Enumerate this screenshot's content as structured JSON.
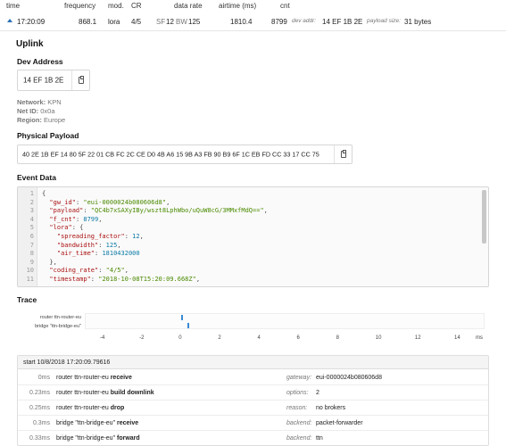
{
  "columns": {
    "time": "time",
    "frequency": "frequency",
    "mod": "mod.",
    "cr": "CR",
    "data_rate": "data rate",
    "airtime": "airtime (ms)",
    "cnt": "cnt"
  },
  "row": {
    "time": "17:20:09",
    "frequency": "868.1",
    "mod": "lora",
    "cr": "4/5",
    "sf_label": "SF",
    "sf": "12",
    "bw_label": "BW",
    "bw": "125",
    "airtime": "1810.4",
    "cnt": "8799",
    "dev_addr_label": "dev addr:",
    "dev_addr": "14 EF 1B 2E",
    "payload_size_label": "payload size:",
    "payload_size": "31 bytes"
  },
  "uplink": {
    "title": "Uplink",
    "dev_address_title": "Dev Address",
    "dev_address": "14 EF 1B 2E",
    "network_label": "Network:",
    "network": "KPN",
    "net_id_label": "Net ID:",
    "net_id": "0x0a",
    "region_label": "Region:",
    "region": "Europe",
    "payload_title": "Physical Payload",
    "payload": "40 2E 1B EF 14 80 5F 22 01 CB FC 2C CE D0 4B A6 15 9B A3 FB 90 B9 6F 1C EB FD CC 33 17 CC 75",
    "event_title": "Event Data"
  },
  "event_lines": [
    {
      "n": "1",
      "parts": [
        [
          "p",
          "{"
        ]
      ]
    },
    {
      "n": "2",
      "parts": [
        [
          "k",
          "  \"gw_id\""
        ],
        [
          "p",
          ": "
        ],
        [
          "s",
          "\"eui-0000024b080606d8\""
        ],
        [
          "p",
          ","
        ]
      ]
    },
    {
      "n": "3",
      "parts": [
        [
          "k",
          "  \"payload\""
        ],
        [
          "p",
          ": "
        ],
        [
          "s",
          "\"QC4b7xSAXyIBy/wszt8LphWbo/uQuW8cG/3MMxfMdQ==\""
        ],
        [
          "p",
          ","
        ]
      ]
    },
    {
      "n": "4",
      "parts": [
        [
          "k",
          "  \"f_cnt\""
        ],
        [
          "p",
          ": "
        ],
        [
          "n",
          "8799"
        ],
        [
          "p",
          ","
        ]
      ]
    },
    {
      "n": "5",
      "parts": [
        [
          "k",
          "  \"lora\""
        ],
        [
          "p",
          ": {"
        ]
      ]
    },
    {
      "n": "6",
      "parts": [
        [
          "k",
          "    \"spreading_factor\""
        ],
        [
          "p",
          ": "
        ],
        [
          "n",
          "12"
        ],
        [
          "p",
          ","
        ]
      ]
    },
    {
      "n": "7",
      "parts": [
        [
          "k",
          "    \"bandwidth\""
        ],
        [
          "p",
          ": "
        ],
        [
          "n",
          "125"
        ],
        [
          "p",
          ","
        ]
      ]
    },
    {
      "n": "8",
      "parts": [
        [
          "k",
          "    \"air_time\""
        ],
        [
          "p",
          ": "
        ],
        [
          "n",
          "1810432000"
        ]
      ]
    },
    {
      "n": "9",
      "parts": [
        [
          "p",
          "  },"
        ]
      ]
    },
    {
      "n": "10",
      "parts": [
        [
          "k",
          "  \"coding_rate\""
        ],
        [
          "p",
          ": "
        ],
        [
          "s",
          "\"4/5\""
        ],
        [
          "p",
          ","
        ]
      ]
    },
    {
      "n": "11",
      "parts": [
        [
          "k",
          "  \"timestamp\""
        ],
        [
          "p",
          ": "
        ],
        [
          "s",
          "\"2018-10-08T15:20:09.668Z\""
        ],
        [
          "p",
          ","
        ]
      ]
    }
  ],
  "trace": {
    "title": "Trace",
    "lanes": [
      "router ttn-router-eu",
      "bridge \"ttn-bridge-eu\""
    ],
    "ticks": [
      "-4",
      "-2",
      "0",
      "2",
      "4",
      "6",
      "8",
      "10",
      "12",
      "14"
    ],
    "unit": "ms",
    "start": "start 10/8/2018 17:20:09.79616",
    "rows": [
      {
        "t": "0ms",
        "prefix": "router ttn-router-eu",
        "action": "receive",
        "key": "gateway:",
        "value": "eui-0000024b080606d8"
      },
      {
        "t": "0.23ms",
        "prefix": "router ttn-router-eu",
        "action": "build downlink",
        "key": "options:",
        "value": "2"
      },
      {
        "t": "0.25ms",
        "prefix": "router ttn-router-eu",
        "action": "drop",
        "key": "reason:",
        "value": "no brokers"
      },
      {
        "t": "0.3ms",
        "prefix": "bridge \"ttn-bridge-eu\"",
        "action": "receive",
        "key": "backend:",
        "value": "packet-forwarder"
      },
      {
        "t": "0.33ms",
        "prefix": "bridge \"ttn-bridge-eu\"",
        "action": "forward",
        "key": "backend:",
        "value": "ttn"
      }
    ]
  },
  "icons": [
    "collapse-arrow-icon",
    "copy-icon"
  ],
  "colors": {
    "accent": "#2a6fb7",
    "trace_mark": "#3a89d4"
  }
}
